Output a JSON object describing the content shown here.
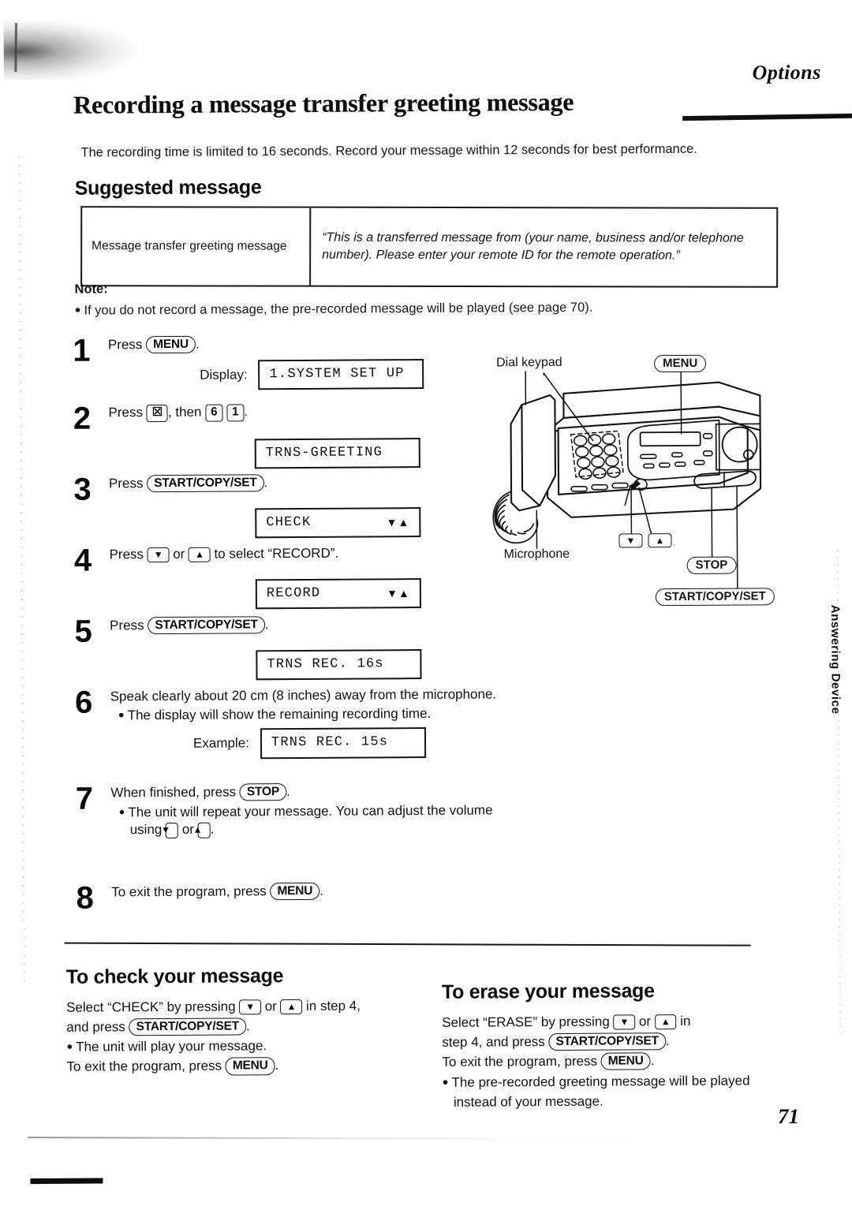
{
  "header": {
    "section_label": "Options",
    "title": "Recording a message transfer greeting message",
    "intro": "The recording time is limited to 16 seconds. Record your message within 12 seconds for best performance."
  },
  "suggested": {
    "heading": "Suggested message",
    "row_label": "Message transfer greeting message",
    "row_text": "“This is a transferred message from (your name, business and/or telephone number). Please enter your remote ID for the remote operation.”"
  },
  "note": {
    "heading": "Note:",
    "item": "If you do not record a message, the pre-recorded message will be played (see page 70)."
  },
  "steps": [
    {
      "num": "1",
      "text_before": "Press",
      "key": "MENU",
      "text_after": ".",
      "display_label": "Display:",
      "lcd": "1.SYSTEM SET UP",
      "lcd_arrows": ""
    },
    {
      "num": "2",
      "text_before": "Press",
      "key": "☒",
      "text_mid": ", then",
      "key2": "6",
      "key3": "1",
      "text_after": ".",
      "lcd": "TRNS-GREETING",
      "lcd_arrows": ""
    },
    {
      "num": "3",
      "text_before": "Press",
      "key": "START/COPY/SET",
      "text_after": ".",
      "lcd": "CHECK",
      "lcd_arrows": "▼▲"
    },
    {
      "num": "4",
      "text_before": "Press",
      "key": "▼",
      "text_mid": "or",
      "key2": "▲",
      "text_after": "to select “RECORD”.",
      "lcd": "RECORD",
      "lcd_arrows": "▼▲"
    },
    {
      "num": "5",
      "text_before": "Press",
      "key": "START/COPY/SET",
      "text_after": ".",
      "lcd": "TRNS REC.  16s",
      "lcd_arrows": ""
    },
    {
      "num": "6",
      "text_main": "Speak clearly about 20 cm (8 inches) away from the microphone.",
      "bullet": "The display will show the remaining recording time.",
      "display_label": "Example:",
      "lcd": "TRNS REC.  15s",
      "lcd_arrows": ""
    },
    {
      "num": "7",
      "text_before": "When finished, press",
      "key": "STOP",
      "text_after": ".",
      "bullet_before": "The unit will repeat your message. You can adjust the volume using",
      "key2": "▼",
      "bullet_mid": "or",
      "key3": "▲",
      "bullet_after": "."
    },
    {
      "num": "8",
      "text_before": "To exit the program, press",
      "key": "MENU",
      "text_after": "."
    }
  ],
  "illustration": {
    "label_dial_keypad": "Dial keypad",
    "label_microphone": "Microphone",
    "key_menu": "MENU",
    "key_stop": "STOP",
    "key_start": "START/COPY/SET",
    "key_down": "▼",
    "key_up": "▲"
  },
  "side_tab": "Answering Device",
  "bottom_left": {
    "heading": "To check your message",
    "line1_a": "Select “CHECK” by pressing",
    "key_down": "▼",
    "line1_b": "or",
    "key_up": "▲",
    "line1_c": "in step 4,",
    "line2_a": "and press",
    "key_start": "START/COPY/SET",
    "line2_b": ".",
    "bullet": "The unit will play your message.",
    "line3_a": "To exit the program, press",
    "key_menu": "MENU",
    "line3_b": "."
  },
  "bottom_right": {
    "heading": "To erase your message",
    "line1_a": "Select “ERASE” by pressing",
    "key_down": "▼",
    "line1_b": "or",
    "key_up": "▲",
    "line1_c": "in",
    "line2_a": "step 4, and press",
    "key_start": "START/COPY/SET",
    "line2_b": ".",
    "line3_a": "To exit the program, press",
    "key_menu": "MENU",
    "line3_b": ".",
    "bullet": "The pre-recorded greeting message will be played instead of your message."
  },
  "page_number": "71"
}
